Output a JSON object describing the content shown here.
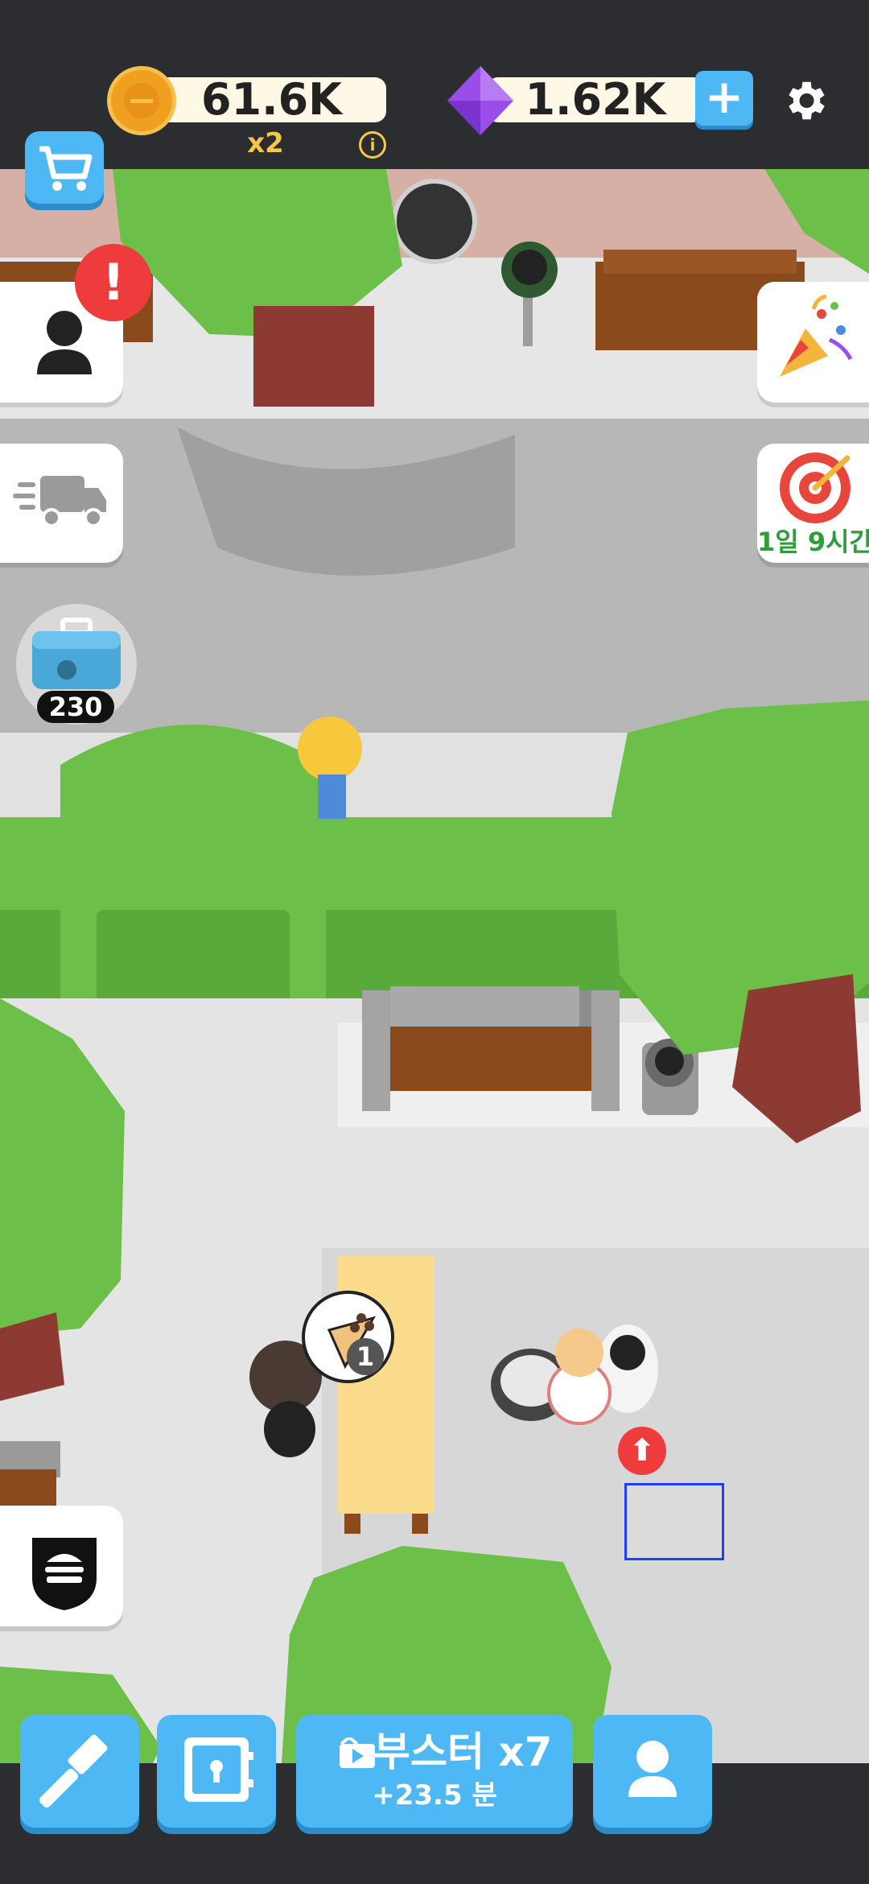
{
  "hud": {
    "coins": "61.6K",
    "coin_multiplier": "x2",
    "info_icon": "i",
    "gems": "1.62K",
    "add_gems_icon": "+"
  },
  "side_left": {
    "profile_alert": "!",
    "toolbox_count": "230"
  },
  "side_right": {
    "goal_timer": "1일 9시간"
  },
  "scene": {
    "order_count": "1"
  },
  "bottom_bar": {
    "booster_label": "부스터 x7",
    "booster_time": "+23.5 분"
  },
  "colors": {
    "accent_blue": "#4db8f3",
    "coin_gold": "#f0a020",
    "gem_purple": "#9a4de8",
    "alert_red": "#ee3b3b",
    "timer_green": "#2e9e3a",
    "grass": "#6cc04a"
  }
}
